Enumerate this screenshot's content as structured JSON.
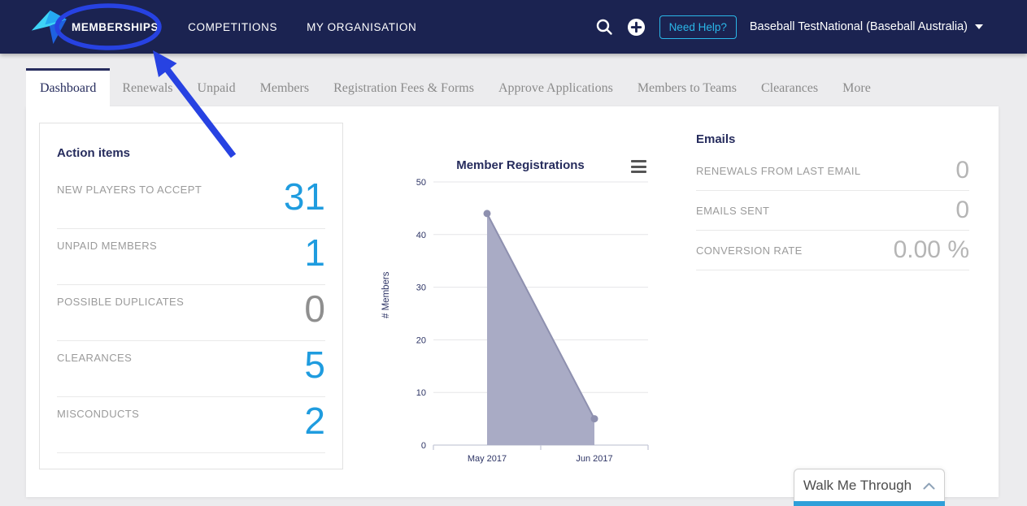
{
  "navbar": {
    "items": [
      {
        "label": "MEMBERSHIPS"
      },
      {
        "label": "COMPETITIONS"
      },
      {
        "label": "MY ORGANISATION"
      }
    ],
    "need_help_label": "Need Help?",
    "org_selector": "Baseball TestNational (Baseball Australia)",
    "icons": [
      "search-icon",
      "add-icon",
      "caret-down-icon"
    ]
  },
  "tabs": [
    {
      "label": "Dashboard",
      "active": true
    },
    {
      "label": "Renewals",
      "active": false
    },
    {
      "label": "Unpaid",
      "active": false
    },
    {
      "label": "Members",
      "active": false
    },
    {
      "label": "Registration Fees & Forms",
      "active": false
    },
    {
      "label": "Approve Applications",
      "active": false
    },
    {
      "label": "Members to Teams",
      "active": false
    },
    {
      "label": "Clearances",
      "active": false
    },
    {
      "label": "More",
      "active": false
    }
  ],
  "action_items": {
    "title": "Action items",
    "rows": [
      {
        "label": "NEW PLAYERS TO ACCEPT",
        "value": "31",
        "highlight": true
      },
      {
        "label": "UNPAID MEMBERS",
        "value": "1",
        "highlight": true
      },
      {
        "label": "POSSIBLE DUPLICATES",
        "value": "0",
        "highlight": false
      },
      {
        "label": "CLEARANCES",
        "value": "5",
        "highlight": true
      },
      {
        "label": "MISCONDUCTS",
        "value": "2",
        "highlight": true
      }
    ]
  },
  "chart_data": {
    "type": "area",
    "title": "Member Registrations",
    "categories": [
      "May 2017",
      "Jun 2017"
    ],
    "values": [
      44,
      5
    ],
    "xlabel": "",
    "ylabel": "# Members",
    "ylim": [
      0,
      50
    ],
    "ytick_step": 10,
    "yticks": [
      0,
      10,
      20,
      30,
      40,
      50
    ],
    "grid": true,
    "legend": false,
    "colors": {
      "area": "#a9abc5",
      "line": "#8e90af",
      "marker": "#8e90af",
      "grid": "#e5e5e8",
      "axis": "#c6c9d8",
      "text": "#2e3566"
    }
  },
  "emails": {
    "title": "Emails",
    "rows": [
      {
        "label": "RENEWALS FROM LAST EMAIL",
        "value": "0"
      },
      {
        "label": "EMAILS SENT",
        "value": "0"
      },
      {
        "label": "CONVERSION RATE",
        "value": "0.00 %"
      }
    ]
  },
  "walkthrough": {
    "label": "Walk Me Through",
    "icon": "chevron-up-icon",
    "accent_color": "#2f9fd9"
  },
  "annotation": {
    "type": "circle-and-arrow",
    "target": "MEMBERSHIPS",
    "color": "#2742e2"
  },
  "colors": {
    "navbar_bg": "#1b2351",
    "page_bg": "#ececee",
    "heading_navy": "#262c5d",
    "accent_blue": "#1f9cdf",
    "need_help_cyan": "#2bb7e8",
    "muted_gray": "#9b9b9b"
  }
}
